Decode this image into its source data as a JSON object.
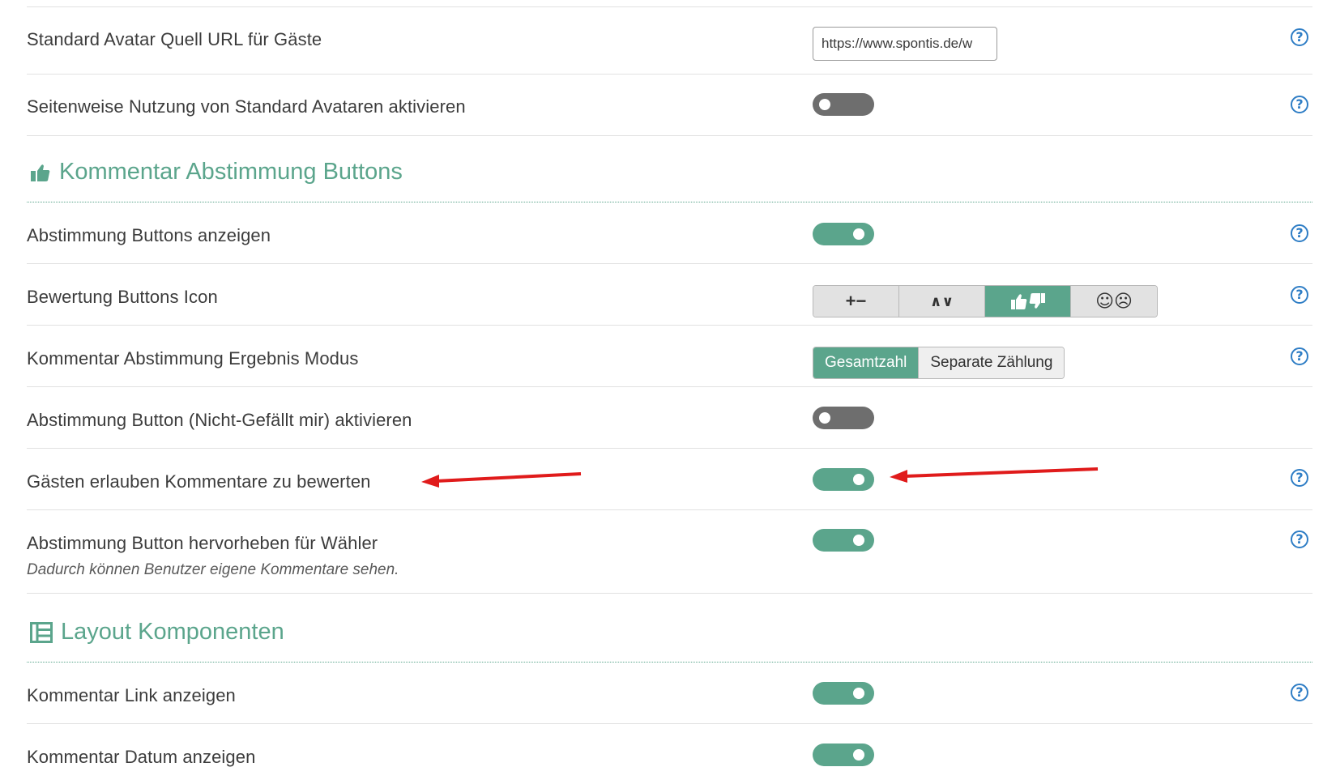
{
  "rows": {
    "avatar_url": {
      "label": "Standard Avatar Quell URL für Gäste",
      "value": "https://www.spontis.de/w"
    },
    "avatar_pages": {
      "label": "Seitenweise Nutzung von Standard Avataren aktivieren",
      "state": "off"
    },
    "show_vote_buttons": {
      "label": "Abstimmung Buttons anzeigen",
      "state": "on"
    },
    "rating_icon": {
      "label": "Bewertung Buttons Icon",
      "options": [
        {
          "icon": "plus-minus-icon",
          "text": "+−"
        },
        {
          "icon": "chevron-up-down-icon",
          "text": "∧∨"
        },
        {
          "icon": "thumbs-up-down-icon",
          "text": ""
        },
        {
          "icon": "smiley-frowny-icon",
          "text": "☺☹"
        }
      ],
      "selected": "thumbs-up-down-icon"
    },
    "result_mode": {
      "label": "Kommentar Abstimmung Ergebnis Modus",
      "options": [
        "Gesamtzahl",
        "Separate Zählung"
      ],
      "selected": "Gesamtzahl"
    },
    "dislike_button": {
      "label": "Abstimmung Button (Nicht-Gefällt mir) aktivieren",
      "state": "off"
    },
    "guest_voting": {
      "label": "Gästen erlauben Kommentare zu bewerten",
      "state": "on"
    },
    "highlight_voter": {
      "label": "Abstimmung Button hervorheben für Wähler",
      "description": "Dadurch können Benutzer eigene Kommentare sehen.",
      "state": "on"
    },
    "comment_link": {
      "label": "Kommentar Link anzeigen",
      "state": "on"
    },
    "comment_date": {
      "label": "Kommentar Datum anzeigen",
      "state": "on"
    }
  },
  "sections": {
    "voting": {
      "title": "Kommentar Abstimmung Buttons",
      "icon": "thumbs-up-icon"
    },
    "layout": {
      "title": "Layout Komponenten",
      "icon": "layout-icon"
    }
  },
  "help_symbol": "?",
  "colors": {
    "accent": "#5ba58c",
    "toggle_off": "#6e6e6e",
    "help": "#2e7dc5",
    "annotation_arrow": "#e01b1b"
  }
}
